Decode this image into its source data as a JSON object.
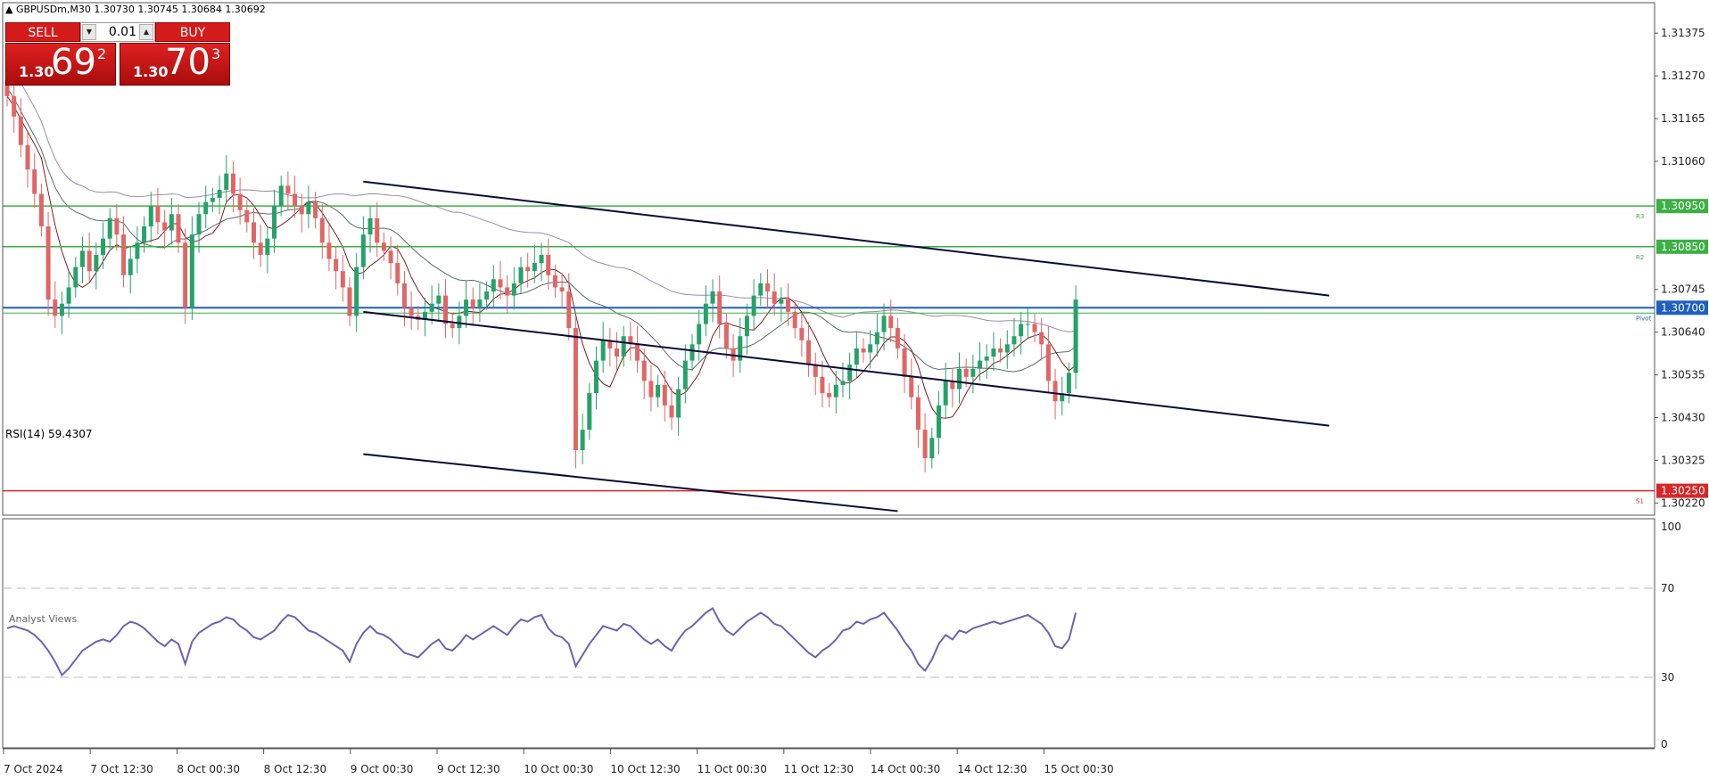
{
  "header": {
    "symbol_line": "▲ GBPUSDm,M30  1.30730 1.30745 1.30684 1.30692"
  },
  "trade_panel": {
    "sell_label": "SELL",
    "buy_label": "BUY",
    "lot_value": "0.01",
    "sell_price": {
      "small": "1.30",
      "big": "69",
      "sup": "2"
    },
    "buy_price": {
      "small": "1.30",
      "big": "70",
      "sup": "3"
    }
  },
  "rsi_label": "RSI(14) 59.4307",
  "analyst_views": "Analyst Views",
  "colors": {
    "bull": "#26a269",
    "bear": "#e06666",
    "resistance": "#3cb043",
    "support": "#d62828",
    "pivot": "#1f5fbf",
    "channel": "#0a0a3a",
    "rsi": "#7060b0",
    "ma_long": "#a08aa8",
    "ma_mid": "#5a6b6b",
    "ma_short": "#7a2020"
  },
  "chart_data": [
    {
      "type": "candlestick",
      "title": "",
      "price_ticks": [
        "1.31375",
        "1.31270",
        "1.31165",
        "1.31060",
        "1.30745",
        "1.30640",
        "1.30535",
        "1.30430",
        "1.30325",
        "1.30220"
      ],
      "ylim": [
        1.3019,
        1.3145
      ],
      "time_ticks": [
        "7 Oct 2024",
        "7 Oct 12:30",
        "8 Oct 00:30",
        "8 Oct 12:30",
        "9 Oct 00:30",
        "9 Oct 12:30",
        "10 Oct 00:30",
        "10 Oct 12:30",
        "11 Oct 00:30",
        "11 Oct 12:30",
        "14 Oct 00:30",
        "14 Oct 12:30",
        "15 Oct 00:30"
      ],
      "horizontal_levels": [
        {
          "label": "1.30950",
          "value": 1.3095,
          "tag": "R3",
          "kind": "resistance"
        },
        {
          "label": "1.30850",
          "value": 1.3085,
          "tag": "R2",
          "kind": "resistance"
        },
        {
          "label": "1.30700",
          "value": 1.307,
          "tag": "Pivot",
          "kind": "pivot"
        },
        {
          "label": "1.30250",
          "value": 1.3025,
          "tag": "S1",
          "kind": "support"
        }
      ],
      "channel_lines": [
        {
          "from": [
            52,
            1.3101
          ],
          "to": [
            193,
            1.3073
          ]
        },
        {
          "from": [
            52,
            1.3069
          ],
          "to": [
            193,
            1.3041
          ]
        },
        {
          "from": [
            52,
            1.3034
          ],
          "to": [
            130,
            1.302
          ]
        }
      ],
      "close": [
        1.3122,
        1.3117,
        1.311,
        1.3104,
        1.3098,
        1.309,
        1.3072,
        1.3068,
        1.3071,
        1.3075,
        1.308,
        1.3084,
        1.3079,
        1.3083,
        1.3087,
        1.3092,
        1.3088,
        1.3078,
        1.3082,
        1.3086,
        1.309,
        1.3095,
        1.3091,
        1.3089,
        1.3093,
        1.3086,
        1.307,
        1.3088,
        1.3093,
        1.3096,
        1.3097,
        1.3099,
        1.3103,
        1.3098,
        1.3094,
        1.3091,
        1.3086,
        1.3083,
        1.3087,
        1.3095,
        1.31,
        1.3098,
        1.3095,
        1.3093,
        1.3096,
        1.3092,
        1.3086,
        1.3082,
        1.3079,
        1.3075,
        1.3068,
        1.308,
        1.3088,
        1.3092,
        1.3086,
        1.3084,
        1.3081,
        1.3076,
        1.307,
        1.3068,
        1.3067,
        1.3069,
        1.3071,
        1.3073,
        1.3066,
        1.3065,
        1.3068,
        1.3072,
        1.307,
        1.3072,
        1.3074,
        1.3077,
        1.3075,
        1.3073,
        1.3076,
        1.308,
        1.3079,
        1.3081,
        1.3083,
        1.3078,
        1.3075,
        1.3074,
        1.3065,
        1.3035,
        1.304,
        1.3049,
        1.3057,
        1.3062,
        1.306,
        1.3058,
        1.3063,
        1.3061,
        1.3057,
        1.3052,
        1.3048,
        1.3051,
        1.3046,
        1.3043,
        1.305,
        1.3057,
        1.3061,
        1.3066,
        1.3071,
        1.3074,
        1.3066,
        1.306,
        1.3057,
        1.3063,
        1.3068,
        1.3073,
        1.3076,
        1.3074,
        1.3071,
        1.3072,
        1.3069,
        1.3065,
        1.3062,
        1.3056,
        1.3053,
        1.3049,
        1.3048,
        1.3051,
        1.3052,
        1.3056,
        1.306,
        1.3059,
        1.3061,
        1.3064,
        1.3068,
        1.3065,
        1.306,
        1.3053,
        1.3048,
        1.304,
        1.3033,
        1.3038,
        1.3046,
        1.3052,
        1.305,
        1.3055,
        1.3053,
        1.3055,
        1.3057,
        1.3058,
        1.306,
        1.3059,
        1.3061,
        1.3063,
        1.3066,
        1.3066,
        1.3064,
        1.3061,
        1.3052,
        1.3047,
        1.3049,
        1.3054,
        1.3072
      ],
      "rsi": {
        "label": "RSI(14) 59.4307",
        "ylim": [
          0,
          100
        ],
        "ticks": [
          "100",
          "70",
          "30",
          "0"
        ],
        "levels": [
          70,
          30
        ],
        "values": [
          52,
          53,
          52,
          51,
          49,
          46,
          42,
          37,
          31,
          34,
          38,
          42,
          44,
          46,
          47,
          46,
          49,
          53,
          55,
          54,
          52,
          49,
          46,
          44,
          47,
          45,
          36,
          46,
          50,
          52,
          54,
          55,
          57,
          56,
          53,
          51,
          48,
          47,
          49,
          51,
          55,
          58,
          57,
          54,
          51,
          50,
          48,
          46,
          44,
          42,
          37,
          45,
          50,
          53,
          50,
          49,
          47,
          44,
          41,
          40,
          39,
          42,
          45,
          47,
          43,
          42,
          45,
          49,
          47,
          49,
          51,
          53,
          51,
          49,
          53,
          56,
          55,
          57,
          58,
          52,
          49,
          48,
          45,
          35,
          40,
          45,
          49,
          53,
          52,
          51,
          54,
          53,
          50,
          47,
          45,
          47,
          44,
          42,
          47,
          51,
          53,
          56,
          59,
          61,
          55,
          51,
          49,
          52,
          55,
          57,
          59,
          57,
          54,
          53,
          50,
          47,
          44,
          41,
          39,
          42,
          44,
          47,
          51,
          52,
          55,
          54,
          56,
          57,
          59,
          55,
          51,
          46,
          42,
          36,
          33,
          38,
          45,
          49,
          47,
          51,
          50,
          52,
          53,
          54,
          55,
          54,
          55,
          56,
          57,
          58,
          56,
          54,
          50,
          44,
          43,
          47,
          59
        ]
      }
    }
  ]
}
